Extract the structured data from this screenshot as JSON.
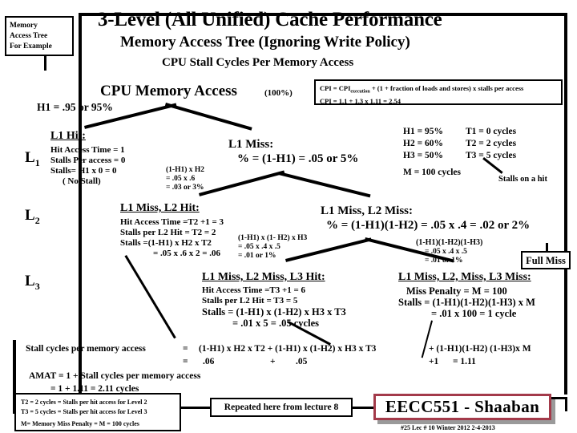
{
  "slide": {
    "memory_tree_label": "Memory\nAccess Tree\nFor Example",
    "memory_tree_line1": "Memory",
    "memory_tree_line2": "Access Tree",
    "memory_tree_line3": "For Example",
    "title1": "3-Level (All Unified) Cache Performance",
    "title2": "Memory Access Tree (Ignoring Write Policy)",
    "title3": "CPU  Stall Cycles Per Memory Access",
    "root_label": "CPU Memory  Access",
    "root_pct": "(100%)",
    "h1_label": "H1 = .95 or  95%"
  },
  "cpi_box": {
    "line1_a": "CPI = CPI",
    "line1_sub": "execution",
    "line1_b": " +  (1 + fraction of loads and stores) x stalls per access",
    "line2": "CPI =      1.1 +                      1.3 x  1.11 = 2.54"
  },
  "params": {
    "rows": [
      {
        "left": "H1  = 95%",
        "right": "T1  = 0 cycles"
      },
      {
        "left": "H2  = 60%",
        "right": "T2 = 2 cycles"
      },
      {
        "left": "H3  = 50%",
        "right": "T3 = 5 cycles"
      }
    ],
    "m_line": "M = 100 cycles",
    "stalls_on_hit": "Stalls on a hit"
  },
  "levels": {
    "l1": "L",
    "l1s": "1",
    "l2": "L",
    "l2s": "2",
    "l3": "L",
    "l3s": "3"
  },
  "nodes": {
    "l1_hit": {
      "head": "L1  Hit:",
      "lines": [
        "Hit Access Time = 1",
        "Stalls Per access = 0",
        "Stalls= H1 x 0 = 0",
        "( No Stall)"
      ]
    },
    "l1_miss": {
      "head": "L1  Miss:",
      "line": "%  =  (1-H1) = .05  or  5%"
    },
    "l1miss_l2hit": {
      "head": "L1  Miss, L2  Hit:",
      "lines": [
        "Hit Access Time =T2 +1 = 3",
        "Stalls per L2 Hit = T2 = 2",
        "Stalls =(1-H1) x H2 x T2",
        "= .05 x .6 x 2 =  .06"
      ]
    },
    "l1miss_l2miss": {
      "head": "L1  Miss, L2   Miss:",
      "line": "%  =    (1-H1)(1-H2) = .05 x .4 = .02 or 2%"
    },
    "l3_hit": {
      "head": "L1  Miss, L2  Miss, L3  Hit:",
      "lines": [
        "Hit Access Time =T3 +1 = 6",
        "Stalls per L2 Hit = T3 = 5",
        "Stalls =  (1-H1) x (1-H2) x H3 x  T3",
        "= .01 x 5 =  .05 cycles"
      ]
    },
    "l3_miss": {
      "head": "L1  Miss, L2, Miss, L3   Miss:",
      "lines": [
        "Miss Penalty = M = 100",
        "Stalls = (1-H1)(1-H2)(1-H3) x M",
        "=  .01 x 100 = 1 cycle"
      ]
    }
  },
  "edge_labels": {
    "e_l2hit": [
      "(1-H1) x H2",
      "= .05  x .6",
      "= .03 or 3%"
    ],
    "e_l3hit": [
      "(1-H1) x (1- H2) x H3",
      "=    .05 x .4 x .5",
      "= .01 or 1%"
    ],
    "e_full": [
      "(1-H1)(1-H2)(1-H3)",
      "=   .05 x .4 x .5",
      "= .01 or 1%"
    ]
  },
  "full_miss_box": "Full Miss",
  "summary": {
    "l1_a": "Stall cycles per memory access",
    "l1_eq": "=",
    "l1_b": "(1-H1) x H2 x T2  +  (1-H1) x (1-H2) x H3 x T3",
    "l1_c": "+ (1-H1)(1-H2) (1-H3)x M",
    "l2_eq": "=",
    "l2_a": ".06",
    "l2_plus": "+",
    "l2_b": ".05",
    "l2_c": "+1",
    "l2_d": "= 1.11",
    "l3": "AMAT  =  1 + Stall cycles per memory access",
    "l4": "=  1 + 1.11 = 2.11 cycles"
  },
  "legend_box": {
    "lines": [
      "T2 = 2 cycles =  Stalls per hit access for Level 2",
      "T3  = 5 cycles =  Stalls per hit access for Level 3",
      "M= Memory Miss Penalty = M = 100 cycles"
    ]
  },
  "footer": {
    "repeated": "Repeated here from lecture 8",
    "signature": "EECC551 - Shaaban",
    "note": "#25   Lec # 10 Winter 2012  2-4-2013",
    "accent": "#a33a4a"
  }
}
